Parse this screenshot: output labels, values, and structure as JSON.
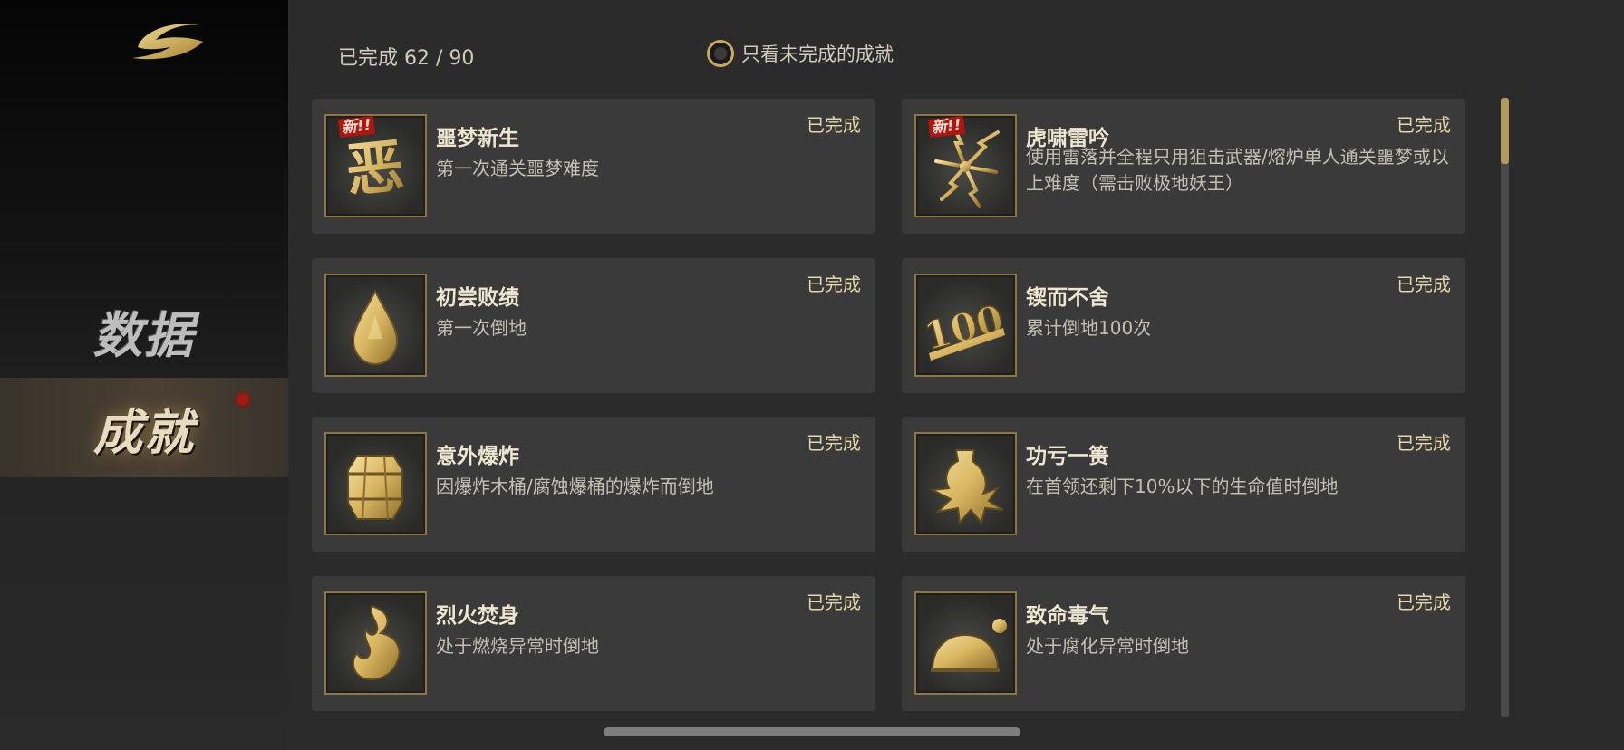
{
  "sidebar": {
    "logo_icon": "crescent-logo-icon",
    "nav": [
      {
        "label": "数据"
      },
      {
        "label": "成就",
        "has_notification": true
      }
    ]
  },
  "header": {
    "progress_label": "已完成",
    "progress_done": 62,
    "progress_total": 90,
    "progress_text": "已完成 62 / 90",
    "filter_label": "只看未完成的成就",
    "filter_checked": false
  },
  "badge_text": "新!!",
  "achievements": [
    {
      "title": "噩梦新生",
      "desc": "第一次通关噩梦难度",
      "status": "已完成",
      "is_new": true,
      "icon": "nightmare-glyph-icon"
    },
    {
      "title": "虎啸雷吟",
      "desc": "使用雷落并全程只用狙击武器/熔炉单人通关噩梦或以上难度（需击败极地妖王）",
      "status": "已完成",
      "is_new": true,
      "icon": "lightning-icon"
    },
    {
      "title": "初尝败绩",
      "desc": "第一次倒地",
      "status": "已完成",
      "is_new": false,
      "icon": "teardrop-icon"
    },
    {
      "title": "锲而不舍",
      "desc": "累计倒地100次",
      "status": "已完成",
      "is_new": false,
      "icon": "100-count-icon"
    },
    {
      "title": "意外爆炸",
      "desc": "因爆炸木桶/腐蚀爆桶的爆炸而倒地",
      "status": "已完成",
      "is_new": false,
      "icon": "barrel-icon"
    },
    {
      "title": "功亏一篑",
      "desc": "在首领还剩下10%以下的生命值时倒地",
      "status": "已完成",
      "is_new": false,
      "icon": "broken-vase-icon"
    },
    {
      "title": "烈火焚身",
      "desc": "处于燃烧异常时倒地",
      "status": "已完成",
      "is_new": false,
      "icon": "flame-icon"
    },
    {
      "title": "致命毒气",
      "desc": "处于腐化异常时倒地",
      "status": "已完成",
      "is_new": false,
      "icon": "poison-dome-icon"
    }
  ],
  "scroll_position": 0.0,
  "colors": {
    "gold": "#c9aa5c",
    "card_bg": "#3a3a3a",
    "page_bg": "#2b2b2b",
    "notification": "#a01818"
  }
}
